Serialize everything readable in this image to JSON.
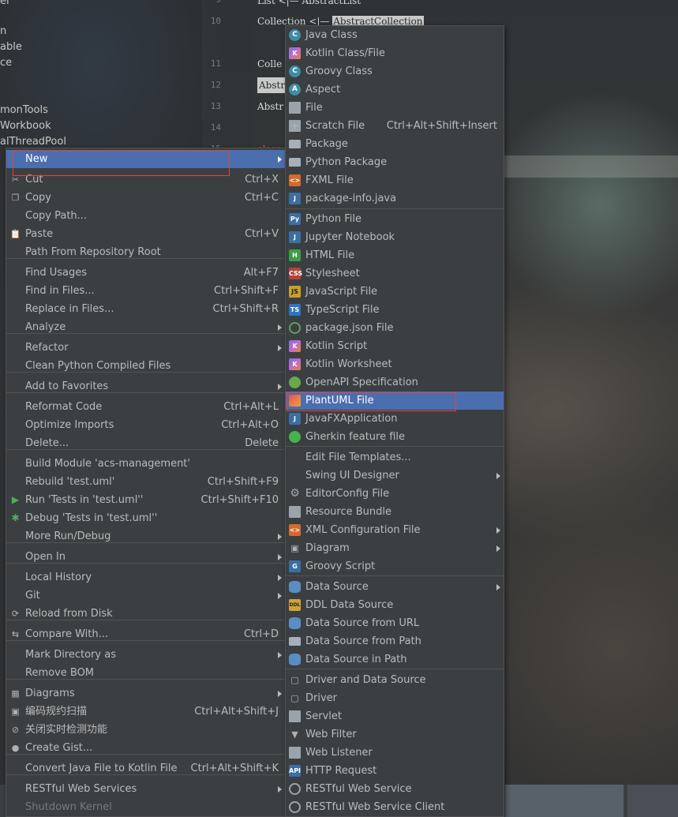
{
  "editor": {
    "line_numbers": [
      "9",
      "10",
      "11",
      "12",
      "13",
      "14",
      "15"
    ],
    "code": {
      "l9": "List <|— AbstractList",
      "l10_pre": "Collection <|— ",
      "l10_hl": "AbstractCollection",
      "l12": "Colle",
      "l13": "Abstr",
      "l14": "Abstr",
      "l16": "class"
    }
  },
  "project_tree": [
    "el",
    "n",
    "able",
    "ce",
    "monTools",
    "Workbook",
    "alThreadPool"
  ],
  "context_menu": {
    "items": [
      {
        "label": "New",
        "shortcut": "",
        "submenu": true
      },
      {
        "label": "Cut",
        "shortcut": "Ctrl+X",
        "icon": "scissors-icon"
      },
      {
        "label": "Copy",
        "shortcut": "Ctrl+C",
        "icon": "copy-icon"
      },
      {
        "label": "Copy Path...",
        "shortcut": ""
      },
      {
        "label": "Paste",
        "shortcut": "Ctrl+V",
        "icon": "clipboard-icon"
      },
      {
        "label": "Path From Repository Root",
        "shortcut": ""
      },
      {
        "label": "Find Usages",
        "shortcut": "Alt+F7"
      },
      {
        "label": "Find in Files...",
        "shortcut": "Ctrl+Shift+F"
      },
      {
        "label": "Replace in Files...",
        "shortcut": "Ctrl+Shift+R"
      },
      {
        "label": "Analyze",
        "shortcut": "",
        "submenu": true
      },
      {
        "label": "Refactor",
        "shortcut": "",
        "submenu": true
      },
      {
        "label": "Clean Python Compiled Files",
        "shortcut": ""
      },
      {
        "label": "Add to Favorites",
        "shortcut": "",
        "submenu": true
      },
      {
        "label": "Reformat Code",
        "shortcut": "Ctrl+Alt+L"
      },
      {
        "label": "Optimize Imports",
        "shortcut": "Ctrl+Alt+O"
      },
      {
        "label": "Delete...",
        "shortcut": "Delete"
      },
      {
        "label": "Build Module 'acs-management'",
        "shortcut": ""
      },
      {
        "label": "Rebuild 'test.uml'",
        "shortcut": "Ctrl+Shift+F9"
      },
      {
        "label": "Run 'Tests in 'test.uml''",
        "shortcut": "Ctrl+Shift+F10",
        "icon": "run-icon"
      },
      {
        "label": "Debug 'Tests in 'test.uml''",
        "shortcut": "",
        "icon": "debug-icon"
      },
      {
        "label": "More Run/Debug",
        "shortcut": "",
        "submenu": true
      },
      {
        "label": "Open In",
        "shortcut": "",
        "submenu": true
      },
      {
        "label": "Local History",
        "shortcut": "",
        "submenu": true
      },
      {
        "label": "Git",
        "shortcut": "",
        "submenu": true
      },
      {
        "label": "Reload from Disk",
        "shortcut": "",
        "icon": "reload-icon"
      },
      {
        "label": "Compare With...",
        "shortcut": "Ctrl+D",
        "icon": "compare-icon"
      },
      {
        "label": "Mark Directory as",
        "shortcut": "",
        "submenu": true
      },
      {
        "label": "Remove BOM",
        "shortcut": ""
      },
      {
        "label": "Diagrams",
        "shortcut": "",
        "submenu": true,
        "icon": "diagram-icon"
      },
      {
        "label": "编码规约扫描",
        "shortcut": "Ctrl+Alt+Shift+J",
        "icon": "scan-icon"
      },
      {
        "label": "关闭实时检测功能",
        "shortcut": "",
        "icon": "block-icon"
      },
      {
        "label": "Create Gist...",
        "shortcut": "",
        "icon": "github-icon"
      },
      {
        "label": "Convert Java File to Kotlin File",
        "shortcut": "Ctrl+Alt+Shift+K"
      },
      {
        "label": "RESTful Web Services",
        "shortcut": "",
        "submenu": true
      },
      {
        "label": "Shutdown Kernel",
        "shortcut": "",
        "disabled": true
      }
    ]
  },
  "new_submenu": {
    "items": [
      {
        "label": "Java Class",
        "shortcut": ""
      },
      {
        "label": "Kotlin Class/File",
        "shortcut": ""
      },
      {
        "label": "Groovy Class",
        "shortcut": ""
      },
      {
        "label": "Aspect",
        "shortcut": ""
      },
      {
        "label": "File",
        "shortcut": ""
      },
      {
        "label": "Scratch File",
        "shortcut": "Ctrl+Alt+Shift+Insert"
      },
      {
        "label": "Package",
        "shortcut": ""
      },
      {
        "label": "Python Package",
        "shortcut": ""
      },
      {
        "label": "FXML File",
        "shortcut": ""
      },
      {
        "label": "package-info.java",
        "shortcut": ""
      },
      {
        "label": "Python File",
        "shortcut": ""
      },
      {
        "label": "Jupyter Notebook",
        "shortcut": ""
      },
      {
        "label": "HTML File",
        "shortcut": ""
      },
      {
        "label": "Stylesheet",
        "shortcut": ""
      },
      {
        "label": "JavaScript File",
        "shortcut": ""
      },
      {
        "label": "TypeScript File",
        "shortcut": ""
      },
      {
        "label": "package.json File",
        "shortcut": ""
      },
      {
        "label": "Kotlin Script",
        "shortcut": ""
      },
      {
        "label": "Kotlin Worksheet",
        "shortcut": ""
      },
      {
        "label": "OpenAPI Specification",
        "shortcut": ""
      },
      {
        "label": "PlantUML File",
        "shortcut": ""
      },
      {
        "label": "JavaFXApplication",
        "shortcut": ""
      },
      {
        "label": "Gherkin feature file",
        "shortcut": ""
      },
      {
        "label": "Edit File Templates...",
        "shortcut": ""
      },
      {
        "label": "Swing UI Designer",
        "shortcut": "",
        "submenu": true
      },
      {
        "label": "EditorConfig File",
        "shortcut": ""
      },
      {
        "label": "Resource Bundle",
        "shortcut": ""
      },
      {
        "label": "XML Configuration File",
        "shortcut": "",
        "submenu": true
      },
      {
        "label": "Diagram",
        "shortcut": "",
        "submenu": true
      },
      {
        "label": "Groovy Script",
        "shortcut": ""
      },
      {
        "label": "Data Source",
        "shortcut": "",
        "submenu": true
      },
      {
        "label": "DDL Data Source",
        "shortcut": ""
      },
      {
        "label": "Data Source from URL",
        "shortcut": ""
      },
      {
        "label": "Data Source from Path",
        "shortcut": ""
      },
      {
        "label": "Data Source in Path",
        "shortcut": ""
      },
      {
        "label": "Driver and Data Source",
        "shortcut": ""
      },
      {
        "label": "Driver",
        "shortcut": ""
      },
      {
        "label": "Servlet",
        "shortcut": ""
      },
      {
        "label": "Web Filter",
        "shortcut": ""
      },
      {
        "label": "Web Listener",
        "shortcut": ""
      },
      {
        "label": "HTTP Request",
        "shortcut": ""
      },
      {
        "label": "RESTful Web Service",
        "shortcut": ""
      },
      {
        "label": "RESTful Web Service Client",
        "shortcut": ""
      }
    ]
  },
  "colors": {
    "menu_bg": "#3c3f41",
    "selection": "#4b6eaf",
    "highlight_box": "#e0453a"
  }
}
